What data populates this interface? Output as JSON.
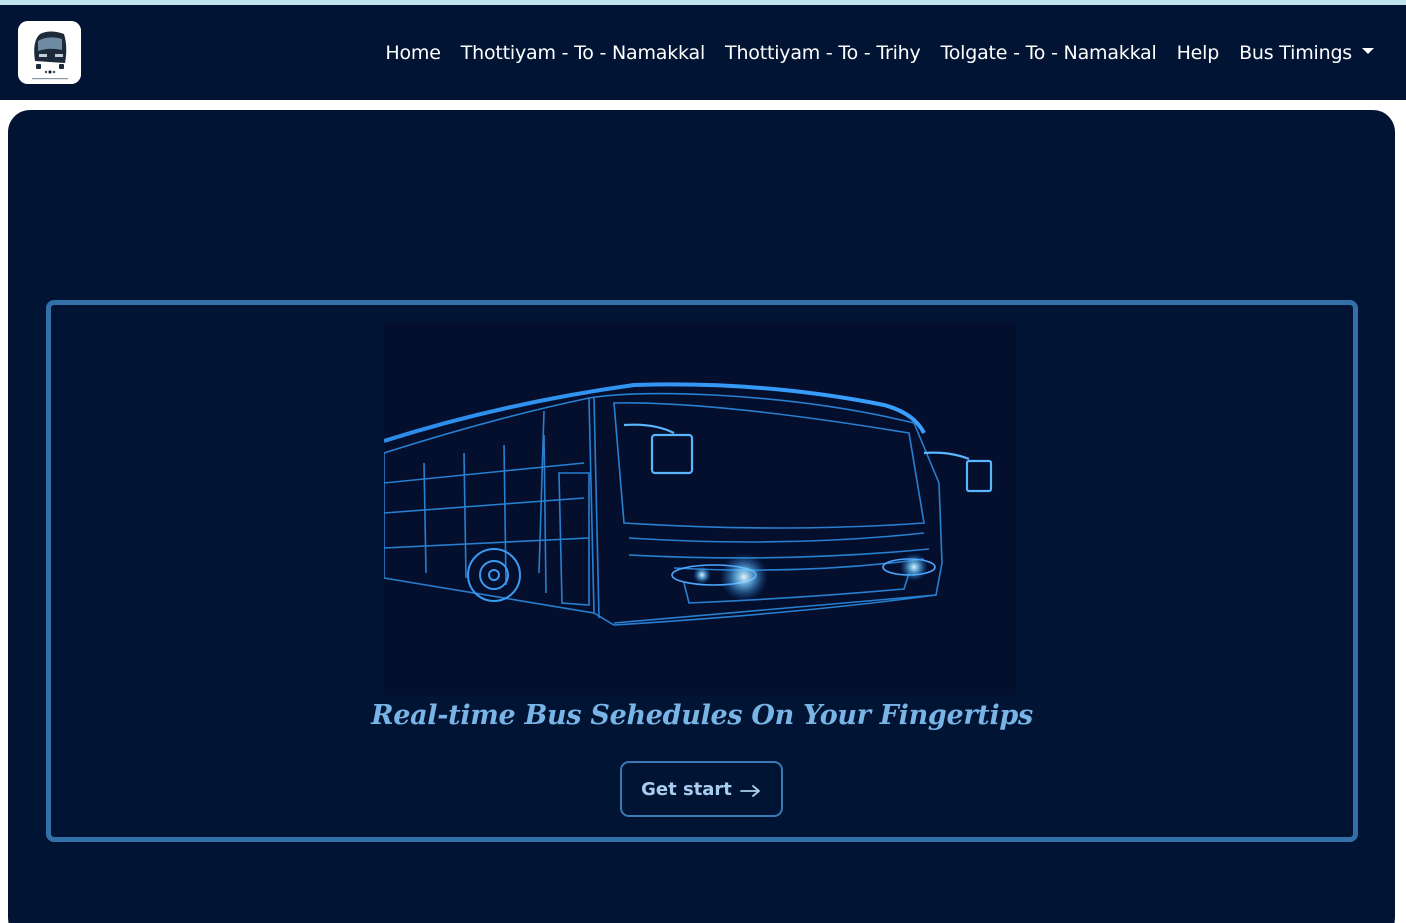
{
  "navbar": {
    "logo_icon": "bus-logo",
    "links": [
      {
        "label": "Home"
      },
      {
        "label": "Thottiyam - To - Namakkal"
      },
      {
        "label": "Thottiyam - To - Trihy"
      },
      {
        "label": "Tolgate - To - Namakkal"
      },
      {
        "label": "Help"
      }
    ],
    "dropdown_label": "Bus Timings"
  },
  "hero": {
    "image_icon": "bus-illustration",
    "tagline": "Real-time Bus Sehedules On Your Fingertips",
    "cta_label": "Get start",
    "cta_icon": "arrow-right-icon"
  },
  "colors": {
    "navbar_bg": "#021434",
    "hero_bg": "#021434",
    "accent": "#3470a8",
    "tagline": "#79b4e6"
  }
}
